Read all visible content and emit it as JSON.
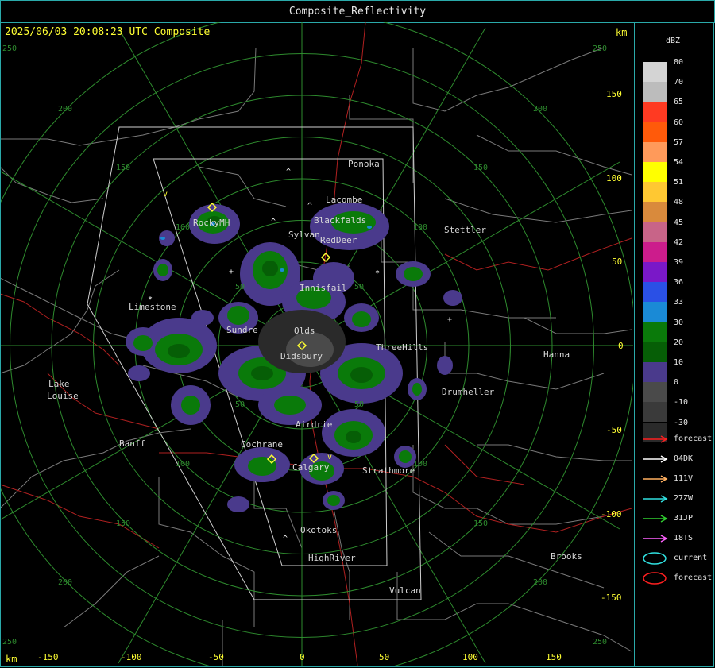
{
  "window": {
    "title": "Composite_Reflectivity"
  },
  "header": {
    "timestamp": "2025/06/03 20:08:23 UTC Composite",
    "km_top": "km",
    "km_bottom": "km"
  },
  "x_ticks": [
    "-150",
    "-100",
    "-50",
    "0",
    "50",
    "100",
    "150"
  ],
  "y_ticks": [
    "150",
    "100",
    "50",
    "0",
    "-50",
    "-100",
    "-150"
  ],
  "ring_labels": [
    "250",
    "200",
    "150",
    "100",
    "50",
    "-50",
    "-100",
    "-150",
    "-200",
    "-250"
  ],
  "towns": [
    "Ponoka",
    "Lacombe",
    "Blackfalds",
    "RockyMH",
    "Sylvan",
    "RedDeer",
    "Stettler",
    "Innisfail",
    "Limestone",
    "Sundre",
    "Olds",
    "ThreeHills",
    "Didsbury",
    "Hanna",
    "Lake",
    "Louise",
    "Drumheller",
    "Airdrie",
    "Banff",
    "Cochrane",
    "Calgary",
    "Strathmore",
    "Okotoks",
    "HighRiver",
    "Brooks",
    "Vulcan"
  ],
  "legend": {
    "unit": "dBZ",
    "levels": [
      {
        "label": "80",
        "color": "#d4d4d4"
      },
      {
        "label": "70",
        "color": "#bcbcbc"
      },
      {
        "label": "65",
        "color": "#ff3a22"
      },
      {
        "label": "60",
        "color": "#ff5a0a"
      },
      {
        "label": "57",
        "color": "#ff9a5a"
      },
      {
        "label": "54",
        "color": "#ffff00"
      },
      {
        "label": "51",
        "color": "#ffc832"
      },
      {
        "label": "48",
        "color": "#d98a3c"
      },
      {
        "label": "45",
        "color": "#c86488"
      },
      {
        "label": "42",
        "color": "#cc1c8c"
      },
      {
        "label": "39",
        "color": "#7a18c8"
      },
      {
        "label": "36",
        "color": "#2a50e6"
      },
      {
        "label": "33",
        "color": "#1a8ad6"
      },
      {
        "label": "30",
        "color": "#0a7a0a"
      },
      {
        "label": "20",
        "color": "#065e06"
      },
      {
        "label": "10",
        "color": "#4a3a8c"
      },
      {
        "label": "0",
        "color": "#4a4a4a"
      },
      {
        "label": "-10",
        "color": "#3a3a3a"
      },
      {
        "label": "-30",
        "color": "#2a2a2a"
      }
    ],
    "tracks": [
      {
        "label": "forecast",
        "color": "#ff2020"
      },
      {
        "label": "04DK",
        "color": "#ffffff"
      },
      {
        "label": "111V",
        "color": "#ffb060"
      },
      {
        "label": "27ZW",
        "color": "#30e0e0"
      },
      {
        "label": "31JP",
        "color": "#30d030"
      },
      {
        "label": "18TS",
        "color": "#ff60ff"
      }
    ],
    "cells": [
      {
        "label": "current",
        "color": "#30e0e0"
      },
      {
        "label": "forecast",
        "color": "#ff2020"
      }
    ]
  }
}
